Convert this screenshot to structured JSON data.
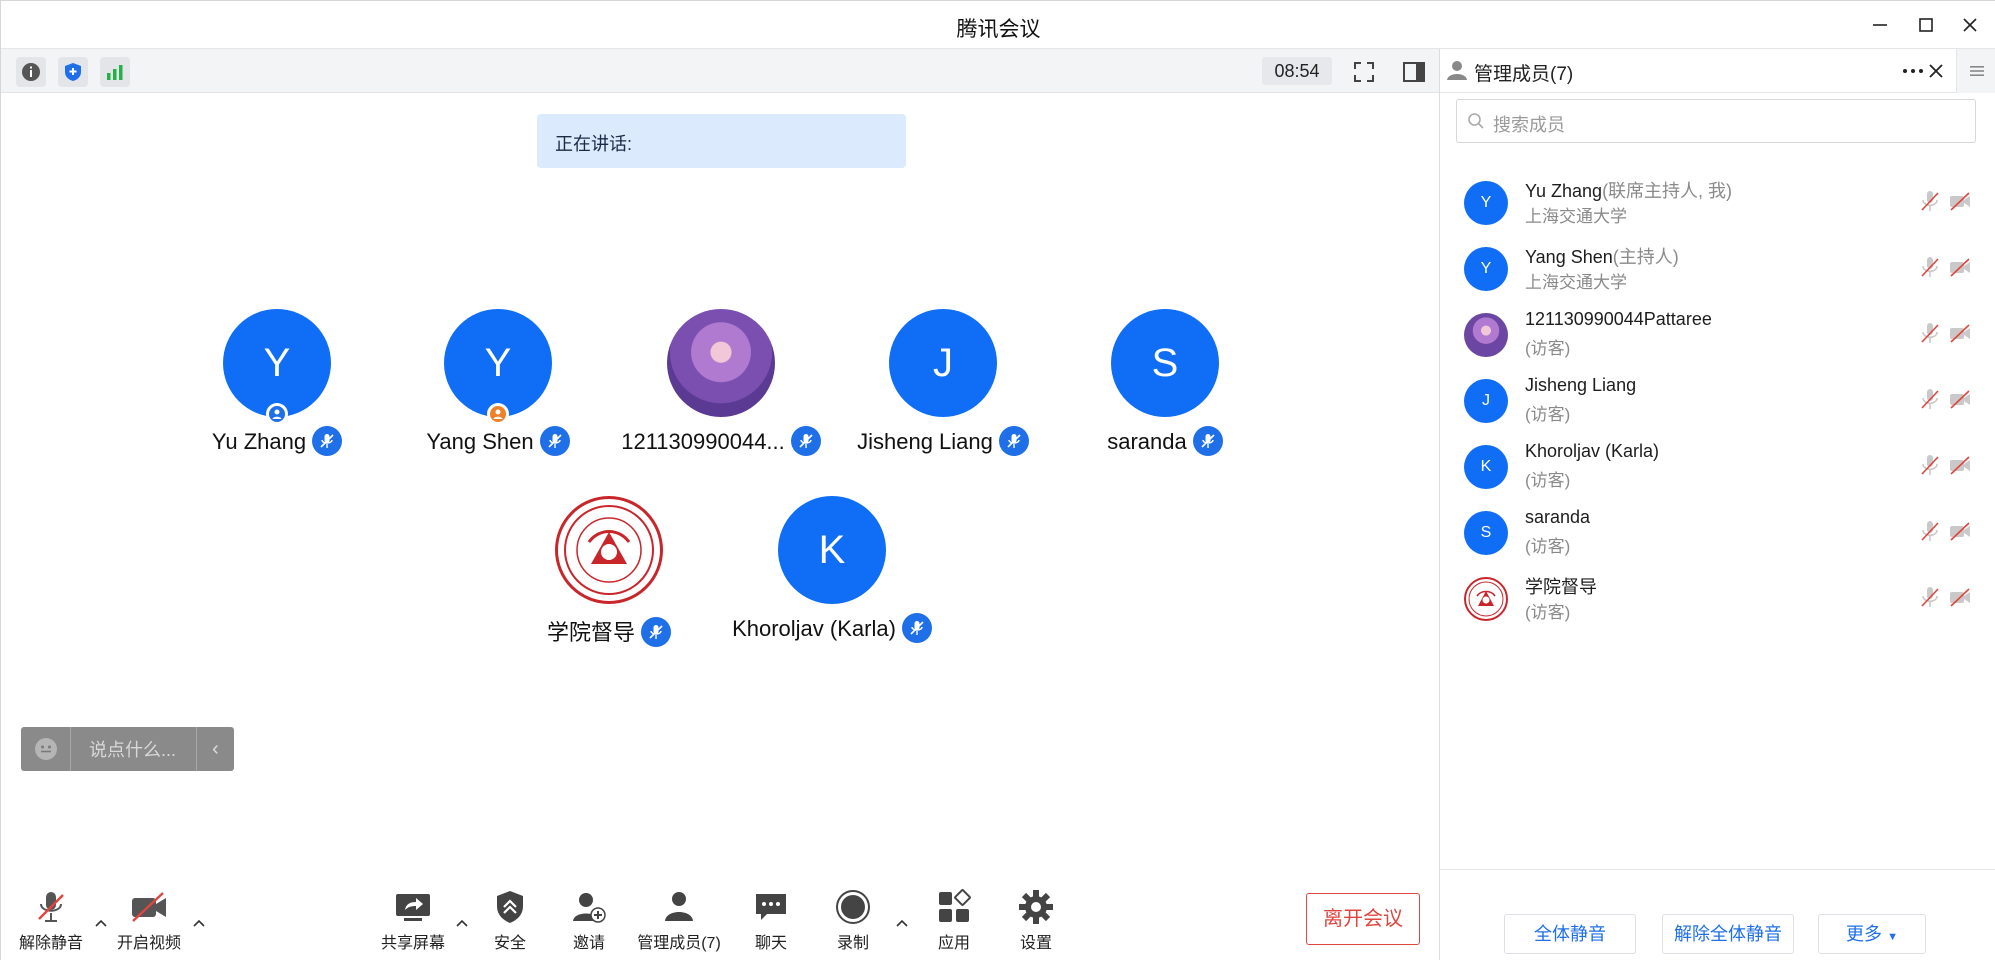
{
  "window": {
    "title": "腾讯会议"
  },
  "toolbar": {
    "timer": "08:54"
  },
  "speaking": {
    "label": "正在讲话:"
  },
  "tiles": [
    {
      "initial": "Y",
      "name": "Yu Zhang",
      "role": "co-host",
      "avatar": "letter"
    },
    {
      "initial": "Y",
      "name": "Yang Shen",
      "role": "host",
      "avatar": "letter"
    },
    {
      "initial": "",
      "name": "121130990044...",
      "role": "",
      "avatar": "photo"
    },
    {
      "initial": "J",
      "name": "Jisheng Liang",
      "role": "",
      "avatar": "letter"
    },
    {
      "initial": "S",
      "name": "saranda",
      "role": "",
      "avatar": "letter"
    },
    {
      "initial": "",
      "name": "学院督导",
      "role": "",
      "avatar": "logo"
    },
    {
      "initial": "K",
      "name": "Khoroljav (Karla)",
      "role": "",
      "avatar": "letter"
    }
  ],
  "chat": {
    "placeholder": "说点什么..."
  },
  "bottom": {
    "unmute": "解除静音",
    "start_video": "开启视频",
    "share_screen": "共享屏幕",
    "security": "安全",
    "invite": "邀请",
    "manage_members": "管理成员(7)",
    "chat": "聊天",
    "record": "录制",
    "apps": "应用",
    "settings": "设置",
    "leave": "离开会议"
  },
  "panel": {
    "title": "管理成员(7)",
    "search_placeholder": "搜索成员",
    "members": [
      {
        "initial": "Y",
        "name": "Yu Zhang",
        "role": "(联席主持人, 我)",
        "sub": "上海交通大学",
        "avatar": "letter"
      },
      {
        "initial": "Y",
        "name": "Yang Shen",
        "role": "(主持人)",
        "sub": "上海交通大学",
        "avatar": "letter"
      },
      {
        "initial": "",
        "name": "121130990044Pattaree",
        "role": "",
        "sub": "(访客)",
        "avatar": "photo"
      },
      {
        "initial": "J",
        "name": "Jisheng Liang",
        "role": "",
        "sub": "(访客)",
        "avatar": "letter"
      },
      {
        "initial": "K",
        "name": "Khoroljav (Karla)",
        "role": "",
        "sub": "(访客)",
        "avatar": "letter"
      },
      {
        "initial": "S",
        "name": "saranda",
        "role": "",
        "sub": "(访客)",
        "avatar": "letter"
      },
      {
        "initial": "",
        "name": "学院督导",
        "role": "",
        "sub": "(访客)",
        "avatar": "logo"
      }
    ],
    "mute_all": "全体静音",
    "unmute_all": "解除全体静音",
    "more": "更多"
  },
  "colors": {
    "accent": "#0f6ef5",
    "leave_red": "#e0453f",
    "speaking_bg": "#dbeafd"
  }
}
